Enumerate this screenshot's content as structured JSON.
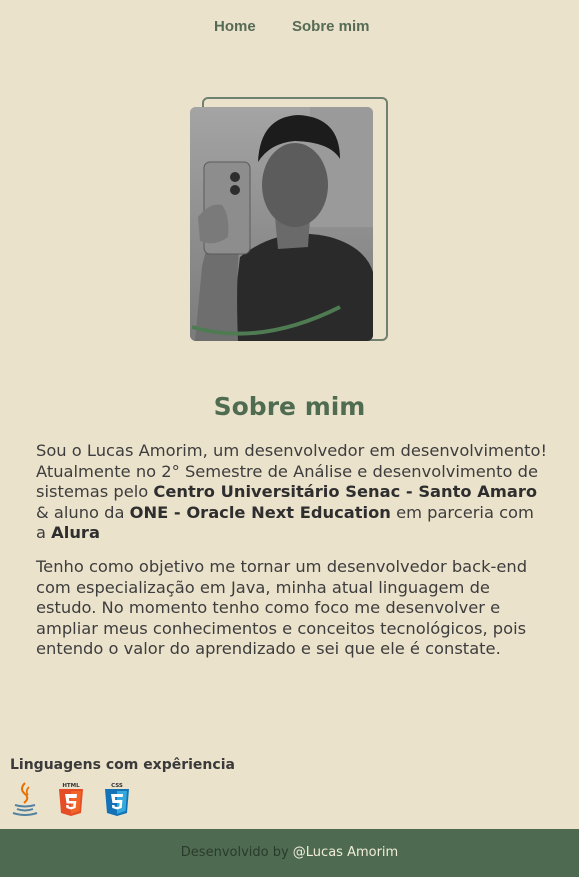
{
  "nav": {
    "home_label": "Home",
    "about_label": "Sobre mim"
  },
  "about": {
    "title": "Sobre mim",
    "p1": {
      "a": "Sou o Lucas Amorim, um desenvolvedor em desenvolvimento! Atualmente no 2° Semestre de Análise e desenvolvimento de sistemas pelo ",
      "b1": "Centro Universitário Senac - Santo Amaro",
      "c": " & aluno da ",
      "b2": "ONE - Oracle Next Education",
      "d": " em parceria com a ",
      "b3": "Alura"
    },
    "p2": "Tenho como objetivo me tornar um desenvolvedor back-end com especialização em Java, minha atual linguagem de estudo. No momento tenho como foco me desenvolver e ampliar meus conhecimentos e conceitos tecnológicos, pois entendo o valor do aprendizado e sei que ele é constate."
  },
  "languages": {
    "title": "Linguagens com expêriencia",
    "icons": [
      "java-icon",
      "html5-icon",
      "css3-icon"
    ],
    "html_badge": "HTML",
    "css_badge": "CSS"
  },
  "footer": {
    "prefix": "Desenvolvido by ",
    "link": "@Lucas Amorim"
  },
  "colors": {
    "background": "#ebe2cc",
    "accent_green": "#4f6b50",
    "footer_bg": "#4e6b52"
  }
}
